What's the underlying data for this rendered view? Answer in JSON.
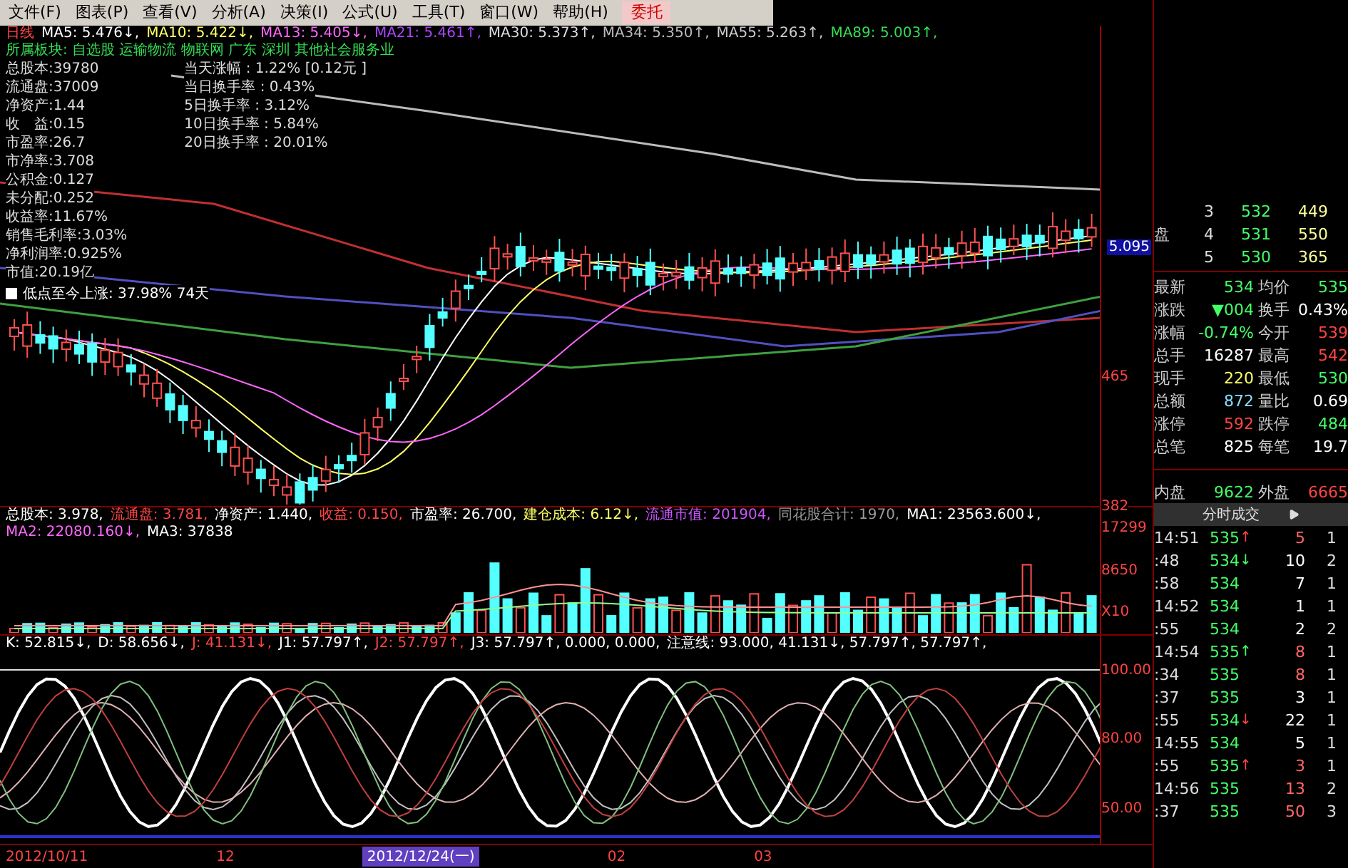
{
  "menu": [
    {
      "label": "文件(F)"
    },
    {
      "label": "图表(P)"
    },
    {
      "label": "查看(V)"
    },
    {
      "label": "分析(A)"
    },
    {
      "label": "决策(I)"
    },
    {
      "label": "公式(U)"
    },
    {
      "label": "工具(T)"
    },
    {
      "label": "窗口(W)"
    },
    {
      "label": "帮助(H)"
    }
  ],
  "trade_button": "委托",
  "chart_header": {
    "period": "日线",
    "averages": [
      {
        "text": "MA5: 5.476↓,",
        "color": "#ffffff"
      },
      {
        "text": "MA10: 5.422↓,",
        "color": "#ffff66"
      },
      {
        "text": "MA13: 5.405↓,",
        "color": "#ff66ff"
      },
      {
        "text": "MA21: 5.461↑,",
        "color": "#aa44ff"
      },
      {
        "text": "MA30: 5.373↑,",
        "color": "#dddddd"
      },
      {
        "text": "MA34: 5.350↑,",
        "color": "#bbbbbb"
      },
      {
        "text": "MA55: 5.263↑,",
        "color": "#cccccc"
      },
      {
        "text": "MA89: 5.003↑,",
        "color": "#33dd55"
      }
    ]
  },
  "sector": "所属板块: 自选股 运输物流 物联网 广东 深圳 其他社会服务业",
  "fundamentals": [
    "总股本:39780",
    "流通盘:37009",
    "净资产:1.44",
    "收　益:0.15",
    "市盈率:26.7",
    "市净率:3.708",
    "公积金:0.127",
    "未分配:0.252",
    "收益率:11.67%",
    "销售毛利率:3.03%",
    "净利润率:0.925%",
    "市值:20.19亿"
  ],
  "turnover": [
    "当天涨幅 : 1.22% [0.12元 ]",
    "当日换手率 : 0.43%",
    "5日换手率 : 3.12%",
    "10日换手率 : 5.84%",
    "20日换手率 : 20.01%"
  ],
  "rally_note": "低点至今上涨: 37.98%  74天",
  "current_price": "5.095",
  "price_ticks": [
    "465",
    "382"
  ],
  "volume_header": [
    {
      "text": "总股本: 3.978,",
      "color": "#ffffff"
    },
    {
      "text": "流通盘: 3.781,",
      "color": "#ff4444"
    },
    {
      "text": "净资产: 1.440,",
      "color": "#ffffff"
    },
    {
      "text": "收益: 0.150,",
      "color": "#ff4444"
    },
    {
      "text": "市盈率: 26.700,",
      "color": "#ffffff"
    },
    {
      "text": "建仓成本: 6.12↓,",
      "color": "#ffff66"
    },
    {
      "text": "流通市值: 201904,",
      "color": "#cc55ff"
    },
    {
      "text": "同花股合计: 1970,",
      "color": "#999999"
    },
    {
      "text": "MA1: 23563.600↓,",
      "color": "#ffffff"
    },
    {
      "text": "MA2: 22080.160↓,",
      "color": "#ff66ff"
    },
    {
      "text": "MA3: 37838",
      "color": "#ffffff"
    }
  ],
  "volume_ticks": [
    "17299",
    "8650"
  ],
  "volume_unit": "X10",
  "indicator_header": [
    {
      "text": "K: 52.815↓,",
      "color": "#ffffff"
    },
    {
      "text": "D: 58.656↓,",
      "color": "#ffffff"
    },
    {
      "text": "J: 41.131↓,",
      "color": "#ff4444"
    },
    {
      "text": "J1: 57.797↑,",
      "color": "#ffffff"
    },
    {
      "text": "J2: 57.797↑,",
      "color": "#ff4444"
    },
    {
      "text": "J3: 57.797↑, 0.000, 0.000,",
      "color": "#ffffff"
    },
    {
      "text": "注意线: 93.000, 41.131↓, 57.797↑, 57.797↑,",
      "color": "#ffffff"
    }
  ],
  "indicator_ticks": [
    "100.00",
    "80.00",
    "50.00"
  ],
  "dates": [
    {
      "label": "2012/10/11",
      "selected": false
    },
    {
      "label": "12",
      "selected": false
    },
    {
      "label": "2012/12/24(一)",
      "selected": true
    },
    {
      "label": "02",
      "selected": false
    },
    {
      "label": "03",
      "selected": false
    }
  ],
  "order_book": [
    {
      "level": "3",
      "price": "532",
      "volume": "449"
    },
    {
      "label": "盘",
      "level": "4",
      "price": "531",
      "volume": "550"
    },
    {
      "level": "5",
      "price": "530",
      "volume": "365"
    }
  ],
  "quote": [
    {
      "label": "最新",
      "value": "534",
      "color": "#44ff66"
    },
    {
      "label": "均价",
      "value": "535",
      "color": "#44ff66"
    },
    {
      "label": "涨跌",
      "value": "▼004",
      "color": "#44ff66"
    },
    {
      "label": "换手",
      "value": "0.43%",
      "color": "#ffffff"
    },
    {
      "label": "涨幅",
      "value": "-0.74%",
      "color": "#44ff66"
    },
    {
      "label": "今开",
      "value": "539",
      "color": "#ff4444"
    },
    {
      "label": "总手",
      "value": "16287",
      "color": "#ffffff"
    },
    {
      "label": "最高",
      "value": "542",
      "color": "#ff4444"
    },
    {
      "label": "现手",
      "value": "220",
      "color": "#ffff66"
    },
    {
      "label": "最低",
      "value": "530",
      "color": "#44ff66"
    },
    {
      "label": "总额",
      "value": "872",
      "color": "#88ddff"
    },
    {
      "label": "量比",
      "value": "0.69",
      "color": "#ffffff"
    },
    {
      "label": "涨停",
      "value": "592",
      "color": "#ff4444"
    },
    {
      "label": "跌停",
      "value": "484",
      "color": "#44ff66"
    },
    {
      "label": "总笔",
      "value": "825",
      "color": "#ffffff"
    },
    {
      "label": "每笔",
      "value": "19.7",
      "color": "#ffffff"
    },
    {
      "label": "内盘",
      "value": "9622",
      "color": "#44ff66"
    },
    {
      "label": "外盘",
      "value": "6665",
      "color": "#ff4444"
    }
  ],
  "trades_title": "分时成交",
  "trades": [
    {
      "time": "14:51",
      "price": "535",
      "arrow": "↑",
      "volume": "5",
      "count": "1",
      "color": "#ff6666"
    },
    {
      "time": ":48",
      "price": "534",
      "arrow": "↓",
      "volume": "10",
      "count": "2",
      "color": "#ffffff"
    },
    {
      "time": ":58",
      "price": "534",
      "volume": "7",
      "count": "1",
      "color": "#ffffff"
    },
    {
      "time": "14:52",
      "price": "534",
      "volume": "1",
      "count": "1",
      "color": "#ffffff"
    },
    {
      "time": ":55",
      "price": "534",
      "volume": "2",
      "count": "2",
      "color": "#ffffff"
    },
    {
      "time": "14:54",
      "price": "535",
      "arrow": "↑",
      "volume": "8",
      "count": "1",
      "color": "#ff6666"
    },
    {
      "time": ":34",
      "price": "535",
      "volume": "8",
      "count": "1",
      "color": "#ff6666"
    },
    {
      "time": ":37",
      "price": "535",
      "volume": "3",
      "count": "1",
      "color": "#ffffff"
    },
    {
      "time": ":55",
      "price": "534",
      "arrow": "↓",
      "volume": "22",
      "count": "1",
      "color": "#ffffff"
    },
    {
      "time": "14:55",
      "price": "534",
      "volume": "5",
      "count": "1",
      "color": "#ffffff"
    },
    {
      "time": ":55",
      "price": "535",
      "arrow": "↑",
      "volume": "3",
      "count": "1",
      "color": "#ff6666"
    },
    {
      "time": "14:56",
      "price": "535",
      "volume": "13",
      "count": "2",
      "color": "#ff6666"
    },
    {
      "time": ":37",
      "price": "535",
      "volume": "50",
      "count": "3",
      "color": "#ff6666"
    }
  ]
}
